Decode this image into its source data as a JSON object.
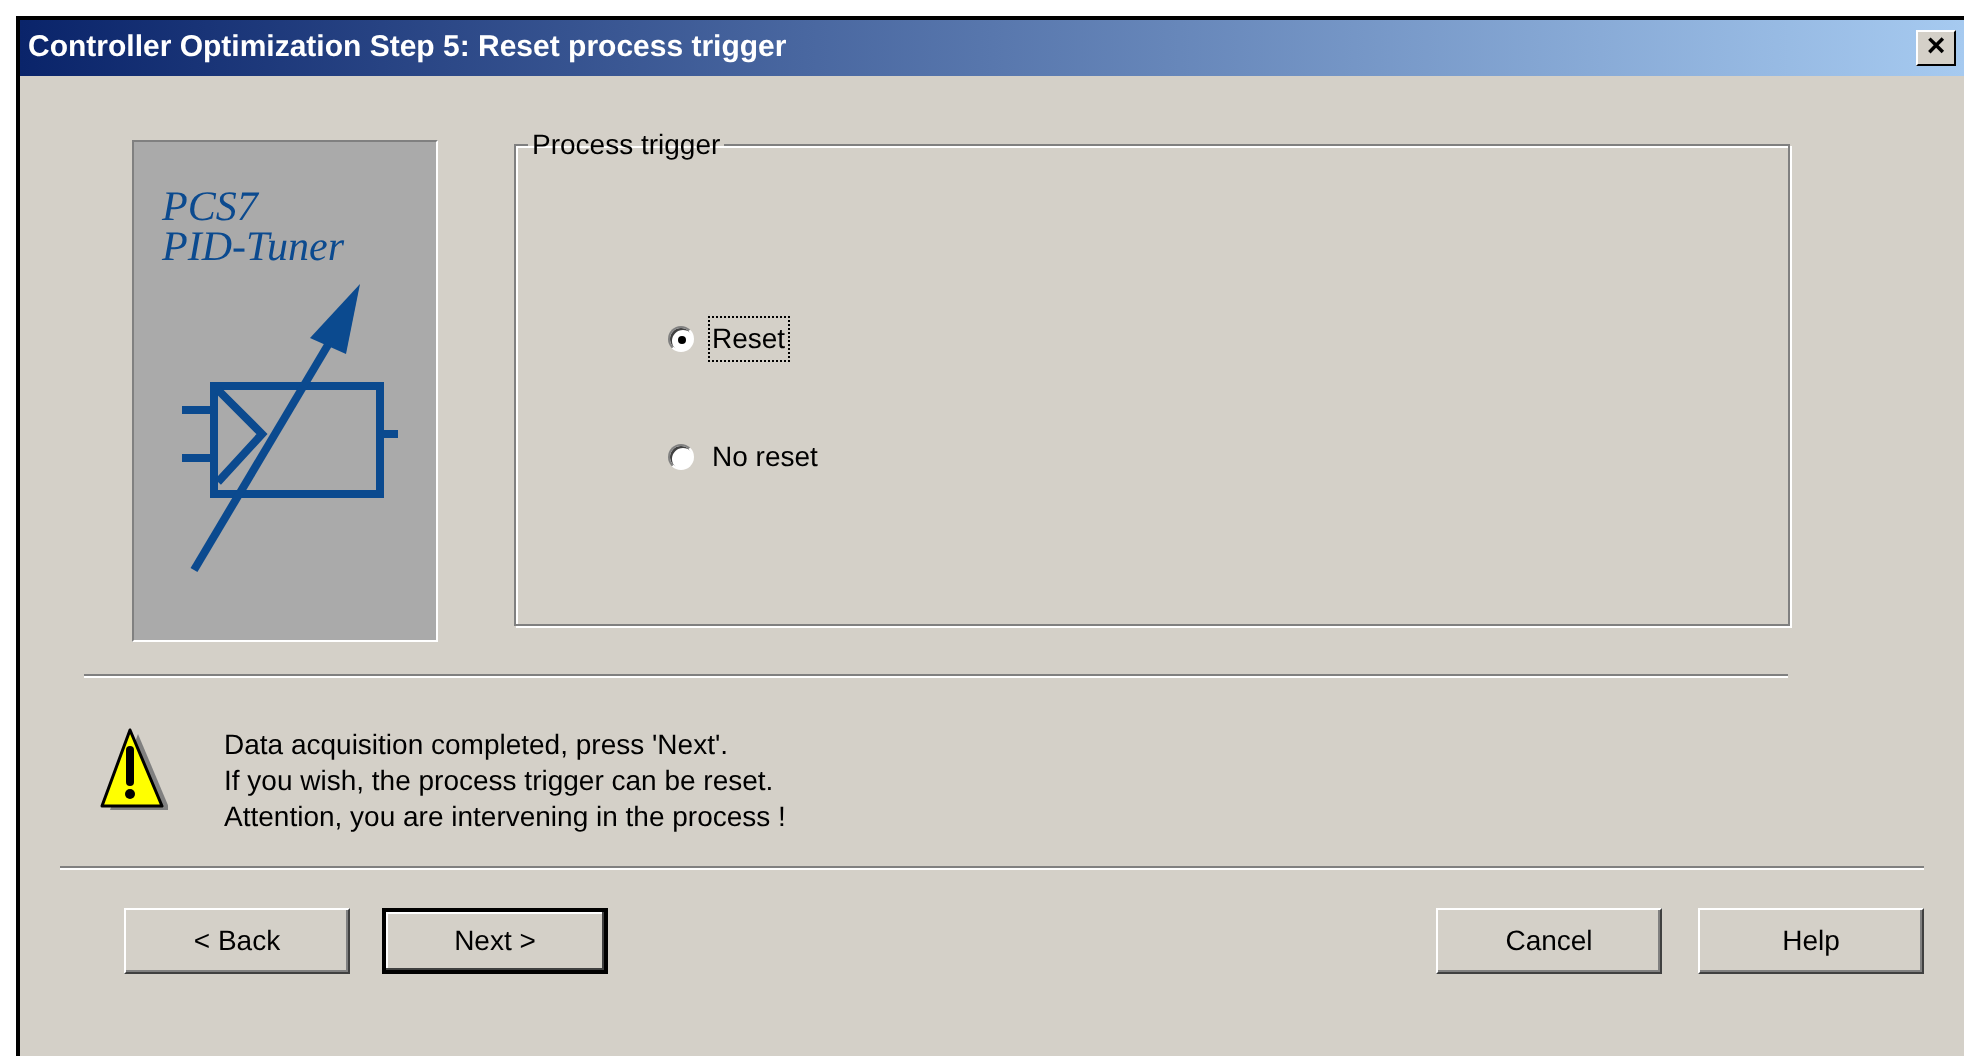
{
  "window": {
    "title": "Controller Optimization Step 5: Reset process trigger",
    "close": "×"
  },
  "logo": {
    "lines": [
      "PCS7",
      "PID-Tuner"
    ]
  },
  "group": {
    "title": "Process trigger",
    "options": [
      {
        "label": "Reset",
        "selected": true
      },
      {
        "label": "No reset",
        "selected": false
      }
    ]
  },
  "message": {
    "lines": [
      "Data acquisition completed, press 'Next'.",
      "If you wish, the process trigger can be reset.",
      "Attention, you are intervening in the process !"
    ]
  },
  "buttons_left": [
    {
      "label": "< Back",
      "default": false
    },
    {
      "label": "Next >",
      "default": true
    }
  ],
  "buttons_right": [
    {
      "label": "Cancel",
      "default": false
    },
    {
      "label": "Help",
      "default": false
    }
  ]
}
